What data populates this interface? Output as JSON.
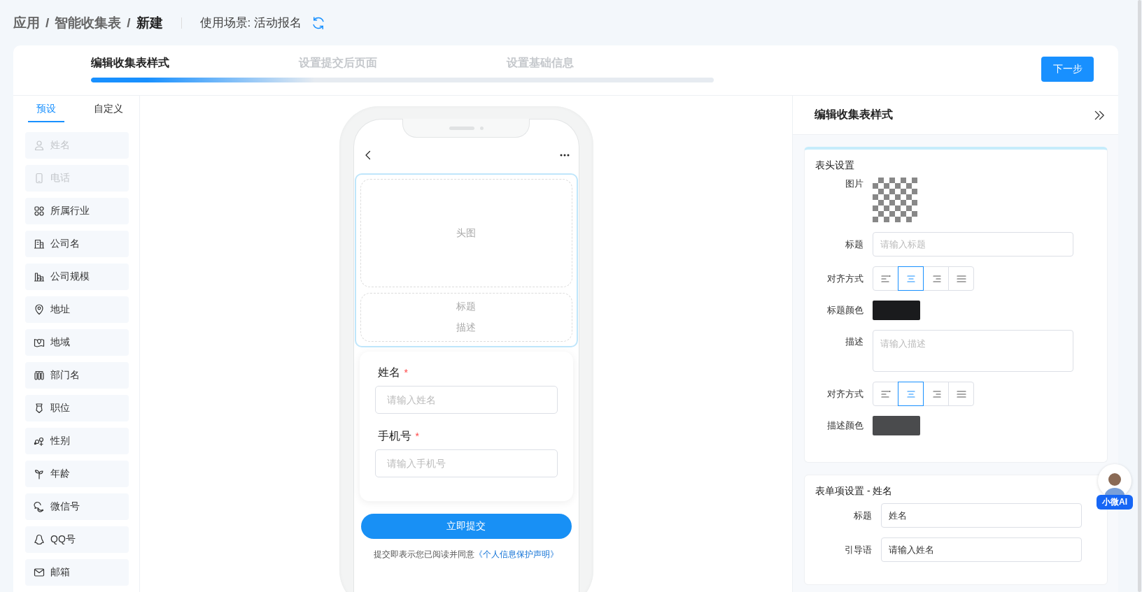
{
  "breadcrumb": {
    "items": [
      "应用",
      "智能收集表",
      "新建"
    ],
    "separator": "/"
  },
  "scene": "使用场景: 活动报名",
  "steps": [
    {
      "label": "编辑收集表样式",
      "selected": true
    },
    {
      "label": "设置提交后页面",
      "selected": false
    },
    {
      "label": "设置基础信息",
      "selected": false
    }
  ],
  "progress": {
    "level": 0.36
  },
  "next_button": "下一步",
  "sidebar": {
    "tabs": [
      {
        "label": "预设",
        "selected": true
      },
      {
        "label": "自定义",
        "selected": false
      }
    ],
    "items": [
      {
        "label": "姓名",
        "disabled": true
      },
      {
        "label": "电话",
        "disabled": true
      },
      {
        "label": "所属行业",
        "disabled": false
      },
      {
        "label": "公司名",
        "disabled": false
      },
      {
        "label": "公司规模",
        "disabled": false
      },
      {
        "label": "地址",
        "disabled": false
      },
      {
        "label": "地域",
        "disabled": false
      },
      {
        "label": "部门名",
        "disabled": false
      },
      {
        "label": "职位",
        "disabled": false
      },
      {
        "label": "性别",
        "disabled": false
      },
      {
        "label": "年龄",
        "disabled": false
      },
      {
        "label": "微信号",
        "disabled": false
      },
      {
        "label": "QQ号",
        "disabled": false
      },
      {
        "label": "邮箱",
        "disabled": false
      }
    ]
  },
  "preview": {
    "header_selected": true,
    "header_image": "头图",
    "title": "标题",
    "description": "描述",
    "required_mark": "*",
    "fields": [
      {
        "label": "姓名",
        "required": true,
        "placeholder": "请输入姓名"
      },
      {
        "label": "手机号",
        "required": true,
        "placeholder": "请输入手机号"
      }
    ],
    "submit": "立即提交",
    "agreement": "提交即表示您已阅读并同意",
    "agreement_link": "《个人信息保护声明》"
  },
  "panel": {
    "title": "编辑收集表样式",
    "header_settings": {
      "title": "表头设置",
      "image_label": "图片",
      "title_label": "标题",
      "title_placeholder": "请输入标题",
      "title_align": {
        "label": "对齐方式",
        "options": [
          {
            "kind": "left",
            "selected": false
          },
          {
            "kind": "center",
            "selected": true
          },
          {
            "kind": "right",
            "selected": false
          },
          {
            "kind": "justify",
            "selected": false
          }
        ]
      },
      "title_color": {
        "label": "标题颜色",
        "color": "#1a1b1d"
      },
      "description_label": "描述",
      "description_placeholder": "请输入描述",
      "description_align": {
        "label": "对齐方式",
        "options": [
          {
            "kind": "left",
            "selected": false
          },
          {
            "kind": "center",
            "selected": true
          },
          {
            "kind": "right",
            "selected": false
          },
          {
            "kind": "justify",
            "selected": false
          }
        ]
      },
      "description_color": {
        "label": "描述颜色",
        "color": "#4a4b4d"
      }
    },
    "item_settings": {
      "title": "表单项设置 - 姓名",
      "rows": [
        {
          "label": "标题",
          "value": "姓名"
        },
        {
          "label": "引导语",
          "value": "请输入姓名"
        }
      ]
    }
  },
  "assistant": {
    "label": "小微AI"
  }
}
